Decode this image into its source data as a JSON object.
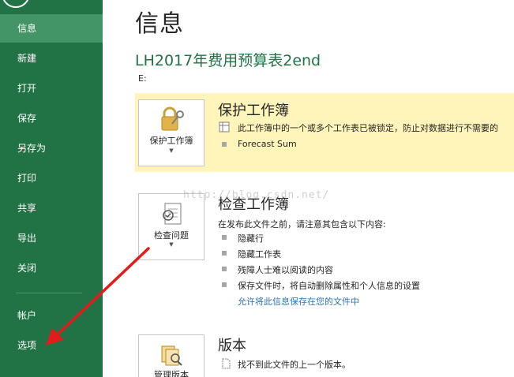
{
  "sidebar": {
    "items": [
      {
        "label": "信息",
        "active": true
      },
      {
        "label": "新建"
      },
      {
        "label": "打开"
      },
      {
        "label": "保存"
      },
      {
        "label": "另存为"
      },
      {
        "label": "打印"
      },
      {
        "label": "共享"
      },
      {
        "label": "导出"
      },
      {
        "label": "关闭"
      },
      {
        "label": "帐户"
      },
      {
        "label": "选项"
      }
    ]
  },
  "main": {
    "title": "信息",
    "workbook_name": "LH2017年费用预算表2end",
    "workbook_path": "E:",
    "protect": {
      "button_label": "保护工作簿",
      "title": "保护工作簿",
      "lines": [
        "此工作簿中的一个或多个工作表已被锁定，防止对数据进行不需要的",
        "Forecast Sum"
      ]
    },
    "inspect": {
      "button_label": "检查问题",
      "title": "检查工作簿",
      "intro": "在发布此文件之前，请注意其包含以下内容:",
      "items": [
        "隐藏行",
        "隐藏工作表",
        "残障人士难以阅读的内容",
        "保存文件时，将自动删除属性和个人信息的设置"
      ],
      "link": "允许将此信息保存在您的文件中"
    },
    "versions": {
      "button_label": "管理版本",
      "title": "版本",
      "line": "找不到此文件的上一个版本。"
    }
  },
  "watermark": "http://blog.csdn.net/",
  "colors": {
    "sidebar": "#217346",
    "sidebar_active": "#439467",
    "protect_bg": "#fff4ba",
    "arrow": "#e31b1b",
    "link": "#2e75b6"
  }
}
